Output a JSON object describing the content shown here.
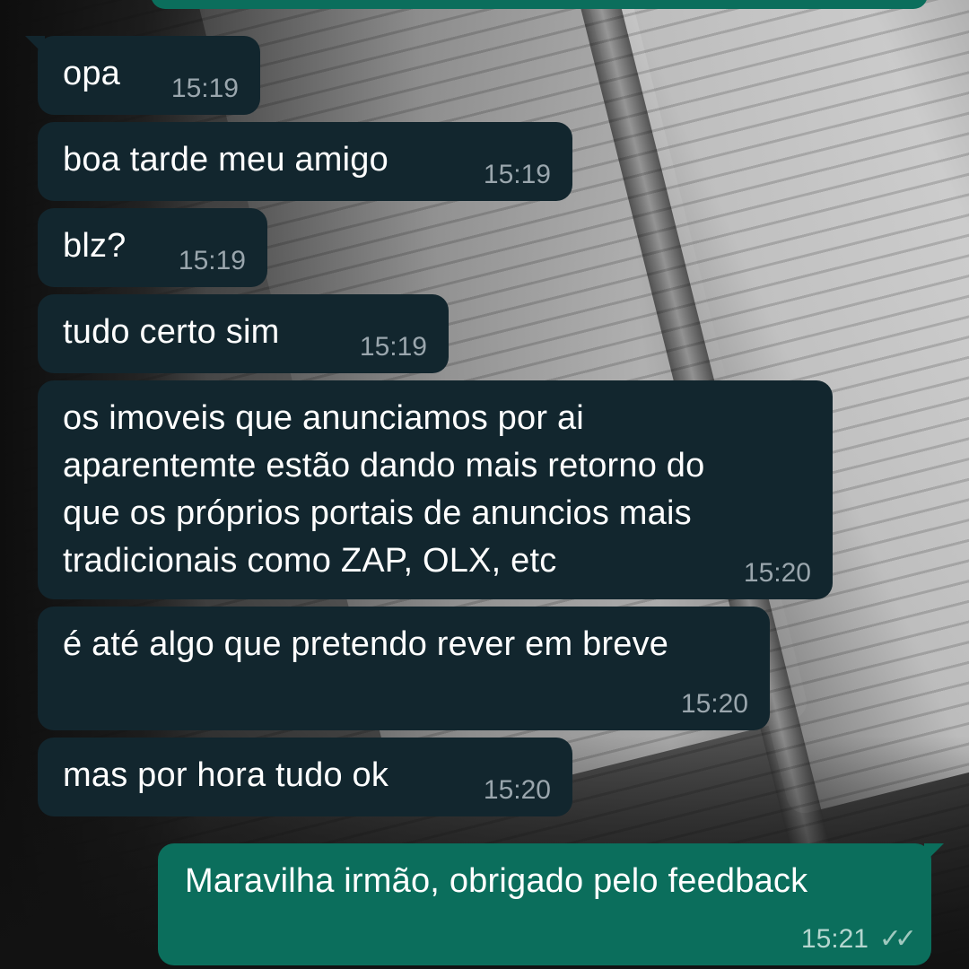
{
  "messages": [
    {
      "text": "opa",
      "time": "15:19"
    },
    {
      "text": "boa tarde meu amigo",
      "time": "15:19"
    },
    {
      "text": "blz?",
      "time": "15:19"
    },
    {
      "text": "tudo certo sim",
      "time": "15:19"
    },
    {
      "text": "os imoveis que anunciamos por ai\naparentemte estão dando mais retorno do\nque os próprios portais de anuncios mais\ntradicionais como ZAP, OLX, etc",
      "time": "15:20"
    },
    {
      "text": "é até algo que pretendo rever em breve",
      "time": "15:20"
    },
    {
      "text": "mas por hora tudo ok",
      "time": "15:20"
    }
  ],
  "outgoing": {
    "text": "Maravilha irmão, obrigado pelo feedback",
    "time": "15:21",
    "status_icon": "double-check-icon"
  },
  "colors": {
    "incoming_bubble": "#12262e",
    "outgoing_bubble": "#0b6e5c",
    "text": "#ffffff",
    "timestamp": "#9aa6ad"
  }
}
